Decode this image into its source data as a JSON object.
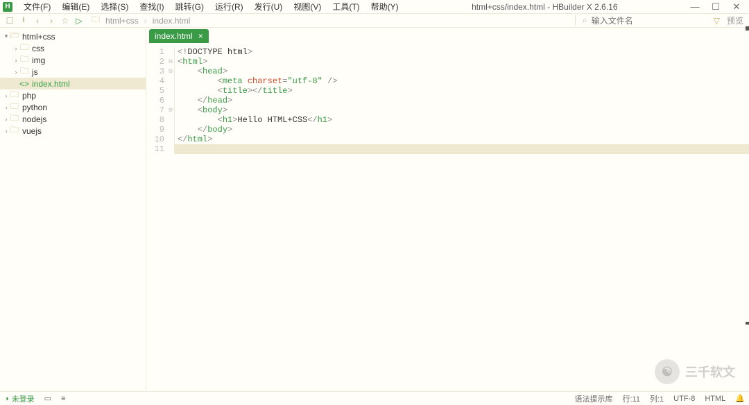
{
  "app": {
    "icon_letter": "H",
    "title": "html+css/index.html - HBuilder X 2.6.16"
  },
  "menu": {
    "items": [
      {
        "label": "文件(F)"
      },
      {
        "label": "编辑(E)"
      },
      {
        "label": "选择(S)"
      },
      {
        "label": "查找(I)"
      },
      {
        "label": "跳转(G)"
      },
      {
        "label": "运行(R)"
      },
      {
        "label": "发行(U)"
      },
      {
        "label": "视图(V)"
      },
      {
        "label": "工具(T)"
      },
      {
        "label": "帮助(Y)"
      }
    ]
  },
  "windowControls": {
    "min": "—",
    "max": "☐",
    "close": "✕"
  },
  "toolbar": {
    "icons": {
      "new_file": "☐",
      "save": "⭳",
      "back": "‹",
      "forward": "›",
      "star": "☆",
      "run": "▷"
    },
    "breadcrumbs": [
      {
        "label": "html+css"
      },
      {
        "label": "index.html"
      }
    ],
    "search_placeholder": "输入文件名",
    "filter": "▽",
    "preview": "预览"
  },
  "sidebar": {
    "items": [
      {
        "indent": 0,
        "chev": "▾",
        "icon": "folder-open",
        "label": "html+css",
        "selected": false
      },
      {
        "indent": 1,
        "chev": "›",
        "icon": "folder",
        "label": "css",
        "selected": false
      },
      {
        "indent": 1,
        "chev": "›",
        "icon": "folder",
        "label": "img",
        "selected": false
      },
      {
        "indent": 1,
        "chev": "›",
        "icon": "folder",
        "label": "js",
        "selected": false
      },
      {
        "indent": 1,
        "chev": "",
        "icon": "file",
        "label": "index.html",
        "selected": true
      },
      {
        "indent": 0,
        "chev": "›",
        "icon": "folder",
        "label": "php",
        "selected": false
      },
      {
        "indent": 0,
        "chev": "›",
        "icon": "folder",
        "label": "python",
        "selected": false
      },
      {
        "indent": 0,
        "chev": "›",
        "icon": "folder",
        "label": "nodejs",
        "selected": false
      },
      {
        "indent": 0,
        "chev": "›",
        "icon": "folder",
        "label": "vuejs",
        "selected": false
      }
    ]
  },
  "tabs": [
    {
      "label": "index.html",
      "active": true
    }
  ],
  "code": {
    "lines": [
      {
        "n": 1,
        "fold": "",
        "html": "<span class='tk-punct'>&lt;!</span><span class='tk-text'>DOCTYPE html</span><span class='tk-punct'>&gt;</span>",
        "indent": 0
      },
      {
        "n": 2,
        "fold": "⊟",
        "html": "<span class='tk-punct'>&lt;</span><span class='tk-tag'>html</span><span class='tk-punct'>&gt;</span>",
        "indent": 0
      },
      {
        "n": 3,
        "fold": "⊟",
        "html": "    <span class='tk-punct'>&lt;</span><span class='tk-tag'>head</span><span class='tk-punct'>&gt;</span>",
        "indent": 0
      },
      {
        "n": 4,
        "fold": "",
        "html": "        <span class='tk-punct'>&lt;</span><span class='tk-tag'>meta</span> <span class='tk-attr'>charset</span><span class='tk-punct'>=</span><span class='tk-str'>\"utf-8\"</span> <span class='tk-punct'>/&gt;</span>",
        "indent": 0
      },
      {
        "n": 5,
        "fold": "",
        "html": "        <span class='tk-punct'>&lt;</span><span class='tk-tag'>title</span><span class='tk-punct'>&gt;&lt;/</span><span class='tk-tag'>title</span><span class='tk-punct'>&gt;</span>",
        "indent": 0
      },
      {
        "n": 6,
        "fold": "",
        "html": "    <span class='tk-punct'>&lt;/</span><span class='tk-tag'>head</span><span class='tk-punct'>&gt;</span>",
        "indent": 0
      },
      {
        "n": 7,
        "fold": "⊟",
        "html": "    <span class='tk-punct'>&lt;</span><span class='tk-tag'>body</span><span class='tk-punct'>&gt;</span>",
        "indent": 0
      },
      {
        "n": 8,
        "fold": "",
        "html": "        <span class='tk-punct'>&lt;</span><span class='tk-tag'>h1</span><span class='tk-punct'>&gt;</span><span class='tk-text'>Hello HTML+CSS</span><span class='tk-punct'>&lt;/</span><span class='tk-tag'>h1</span><span class='tk-punct'>&gt;</span>",
        "indent": 0
      },
      {
        "n": 9,
        "fold": "",
        "html": "    <span class='tk-punct'>&lt;/</span><span class='tk-tag'>body</span><span class='tk-punct'>&gt;</span>",
        "indent": 0
      },
      {
        "n": 10,
        "fold": "",
        "html": "<span class='tk-punct'>&lt;/</span><span class='tk-tag'>html</span><span class='tk-punct'>&gt;</span>",
        "indent": 0
      },
      {
        "n": 11,
        "fold": "",
        "html": "",
        "indent": 0,
        "current": true
      }
    ]
  },
  "status": {
    "login_icon": "◑",
    "login": "未登录",
    "term_icon": "▭",
    "list_icon": "≡",
    "syntax": "语法提示库",
    "line": "行:11",
    "col": "列:1",
    "encoding": "UTF-8",
    "lang": "HTML",
    "bell": "🔔"
  },
  "watermark": {
    "text": "三千软文"
  }
}
